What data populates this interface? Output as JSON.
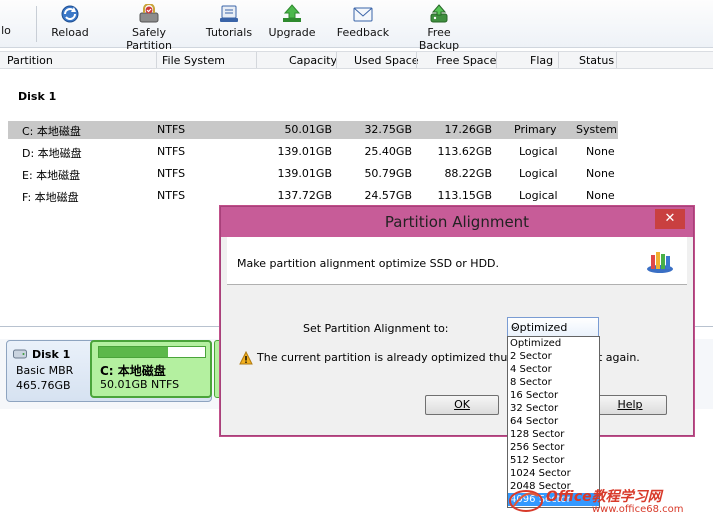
{
  "toolbar": {
    "clipped_left_label": "lo",
    "buttons": [
      {
        "label": "Reload",
        "icon": "reload-icon"
      },
      {
        "label": "Safely Partition",
        "icon": "safely-partition-icon"
      },
      {
        "label": "Tutorials",
        "icon": "tutorials-icon"
      },
      {
        "label": "Upgrade",
        "icon": "upgrade-icon"
      },
      {
        "label": "Feedback",
        "icon": "feedback-icon"
      },
      {
        "label": "Free Backup",
        "icon": "free-backup-icon"
      }
    ]
  },
  "columns": [
    "Partition",
    "File System",
    "Capacity",
    "Used Space",
    "Free Space",
    "Flag",
    "Status"
  ],
  "disk_group": "Disk 1",
  "partitions": [
    {
      "name": "C: 本地磁盘",
      "fs": "NTFS",
      "capacity": "50.01GB",
      "used": "32.75GB",
      "free": "17.26GB",
      "flag": "Primary",
      "status": "System"
    },
    {
      "name": "D: 本地磁盘",
      "fs": "NTFS",
      "capacity": "139.01GB",
      "used": "25.40GB",
      "free": "113.62GB",
      "flag": "Logical",
      "status": "None"
    },
    {
      "name": "E: 本地磁盘",
      "fs": "NTFS",
      "capacity": "139.01GB",
      "used": "50.79GB",
      "free": "88.22GB",
      "flag": "Logical",
      "status": "None"
    },
    {
      "name": "F: 本地磁盘",
      "fs": "NTFS",
      "capacity": "137.72GB",
      "used": "24.57GB",
      "free": "113.15GB",
      "flag": "Logical",
      "status": "None"
    }
  ],
  "disk_map": {
    "disk_name": "Disk 1",
    "disk_type": "Basic MBR",
    "disk_size": "465.76GB",
    "partition_name": "C: 本地磁盘",
    "partition_info": "50.01GB NTFS",
    "partition_usage_fraction": 0.65
  },
  "dialog": {
    "title": "Partition Alignment",
    "close_label": "✕",
    "description": "Make partition alignment optimize SSD or HDD.",
    "set_label": "Set Partition Alignment to:",
    "selected": "Optimized",
    "warning": "The current partition is already optimized thus there",
    "warning_tail": "t again.",
    "ok_label": "OK",
    "help_label": "Help"
  },
  "dropdown_options": [
    "Optimized",
    "2 Sector",
    "4 Sector",
    "8 Sector",
    "16 Sector",
    "32 Sector",
    "64 Sector",
    "128 Sector",
    "256 Sector",
    "512 Sector",
    "1024 Sector",
    "2048 Sector",
    "4096 Sector"
  ],
  "dropdown_highlighted": "4096 Sector",
  "watermark": {
    "line1": "Office教程学习网",
    "line2": "www.office68.com"
  },
  "colors": {
    "dialog_title": "#c75c98",
    "selection": "#3399ff",
    "partition_green": "#b4f0a0"
  }
}
